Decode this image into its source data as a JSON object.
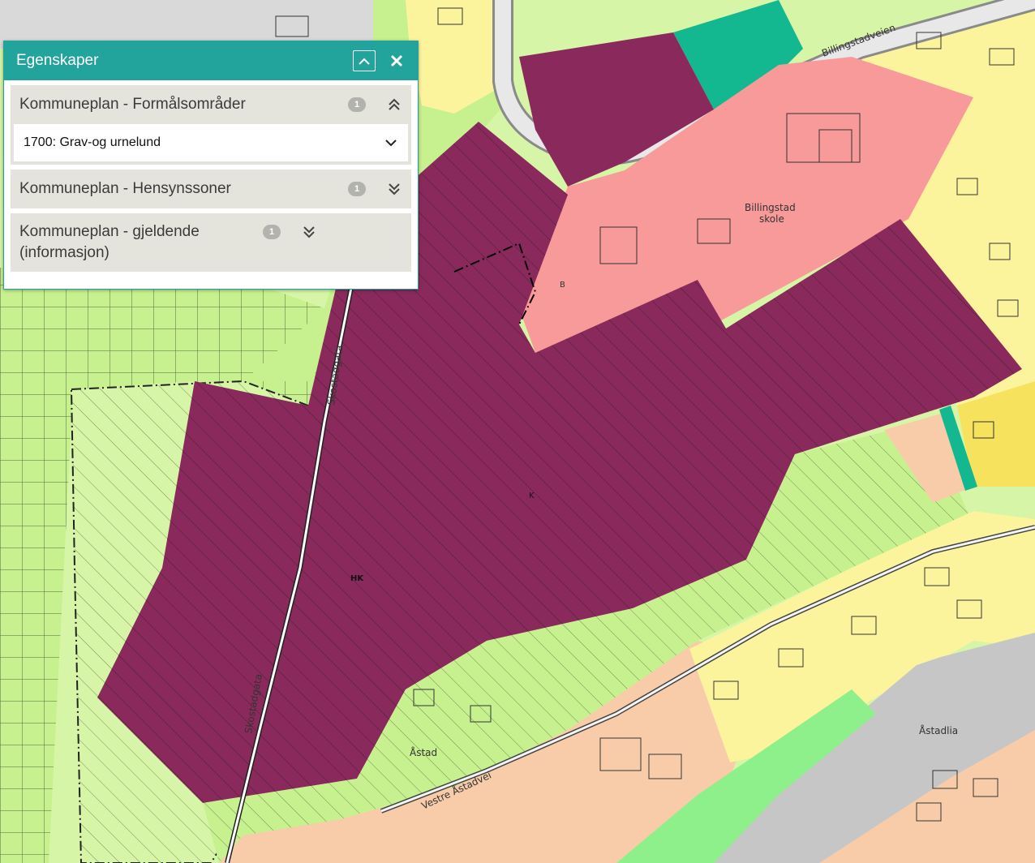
{
  "panel": {
    "title": "Egenskaper",
    "icons": {
      "collapse": "chevron-up-icon",
      "close": "close-icon"
    },
    "sections": [
      {
        "label": "Kommuneplan - Formålsområder",
        "count": "1",
        "state": "expanded"
      },
      {
        "label": "Kommuneplan - Hensynssoner",
        "count": "1",
        "state": "collapsed"
      },
      {
        "label": "Kommuneplan - gjeldende (informasjon)",
        "count": "1",
        "state": "collapsed"
      }
    ],
    "expanded_item": {
      "label": "1700: Grav-og urnelund"
    }
  },
  "map": {
    "colors": {
      "green": "#c7f08f",
      "light_green": "#d6f5a6",
      "plum": "#8a2a5c",
      "pink": "#f89a9a",
      "yellow": "#fbf49c",
      "orange_yellow": "#f6e25c",
      "peach": "#f8cca8",
      "teal": "#14b890",
      "grey": "#c6c6c6",
      "bright_green": "#8ef08a"
    },
    "labels": {
      "billingstadveien": "Billingstadveien",
      "school_line1": "Billingstad",
      "school_line2": "skole",
      "skostadgata_upper": "Skostadgata",
      "skostadgata_lower": "Skostadgata",
      "astad": "Åstad",
      "vestre_astadvei": "Vestre Åstadvei",
      "astadlia": "Åstadlia",
      "code_b": "B",
      "code_k": "K",
      "code_hk": "HK"
    }
  }
}
